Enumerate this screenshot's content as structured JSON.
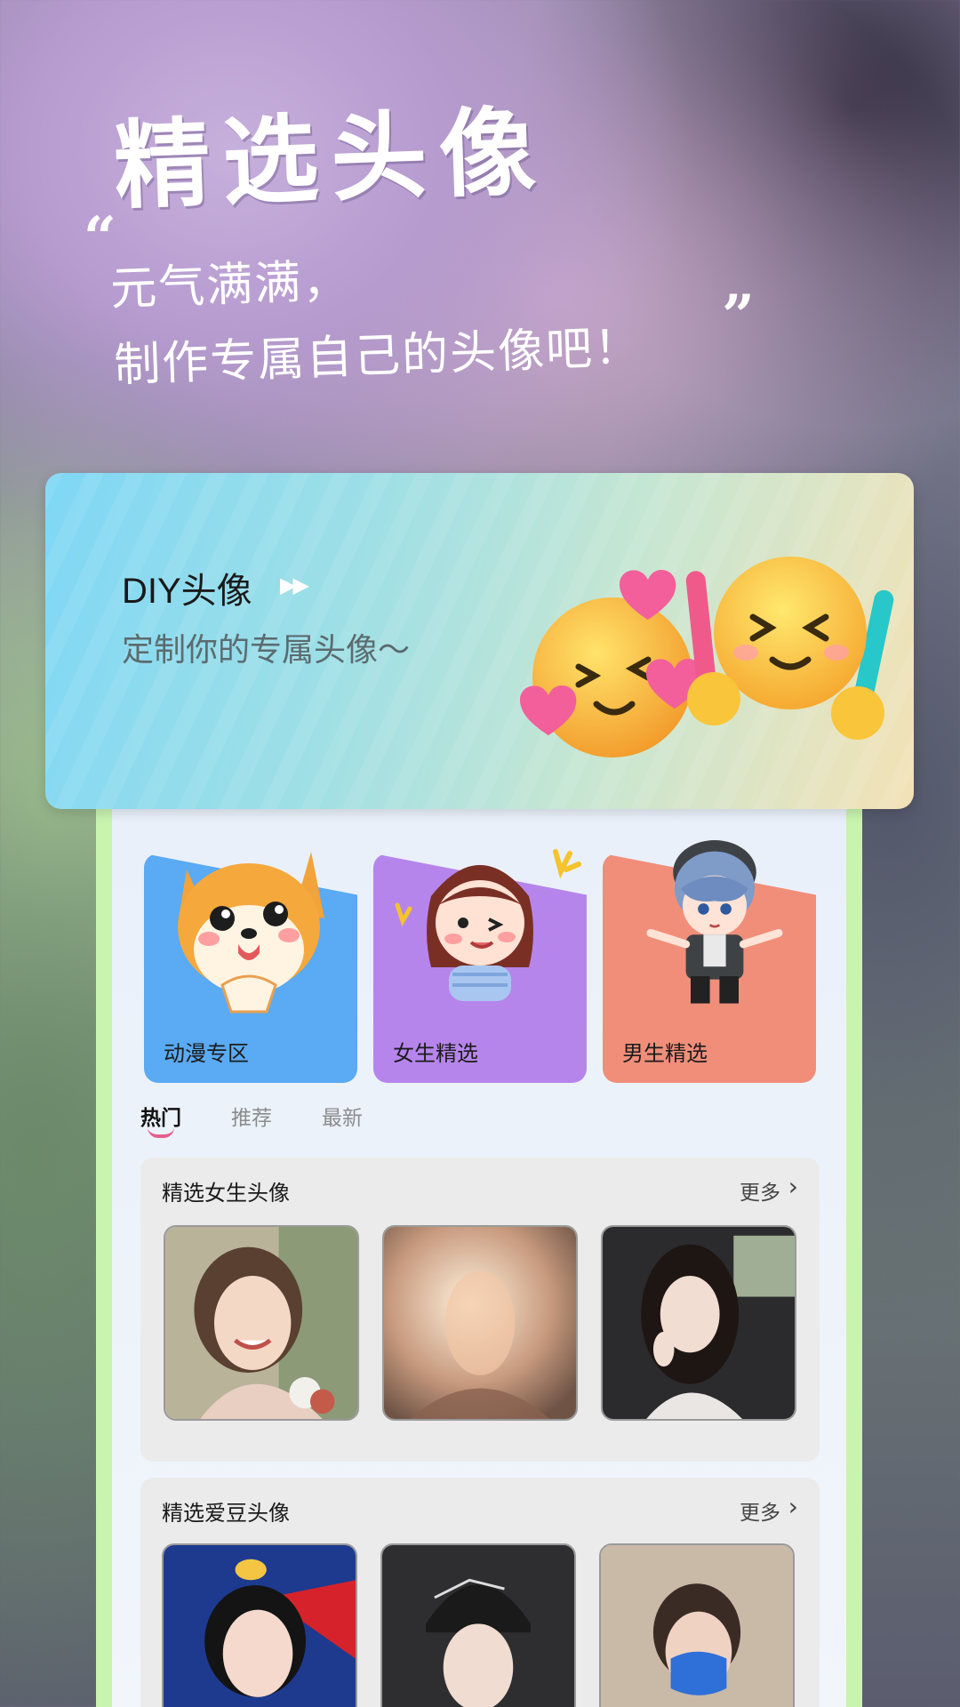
{
  "hero": {
    "title": "精选头像",
    "quote_open": "“",
    "line1": "元气满满，",
    "line2": "制作专属自己的头像吧！",
    "quote_close": "”"
  },
  "diy": {
    "title": "DIY头像",
    "arrows": "▶▶",
    "subtitle": "定制你的专属头像～"
  },
  "categories": [
    {
      "label": "动漫专区",
      "color": "#5aaaf4",
      "icon": "shiba-dog-icon"
    },
    {
      "label": "女生精选",
      "color": "#b685ec",
      "icon": "girl-cartoon-icon"
    },
    {
      "label": "男生精选",
      "color": "#f08e7a",
      "icon": "boy-cartoon-icon"
    }
  ],
  "tabs": [
    "热门",
    "推荐",
    "最新"
  ],
  "sections": [
    {
      "title": "精选女生头像",
      "more": "更多",
      "chevron": "›"
    },
    {
      "title": "精选爱豆头像",
      "more": "更多",
      "chevron": "›"
    }
  ]
}
